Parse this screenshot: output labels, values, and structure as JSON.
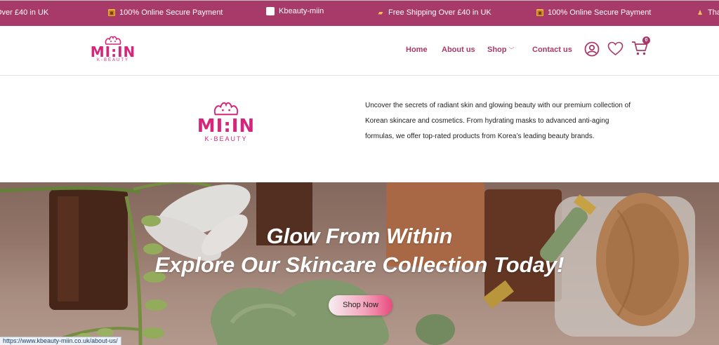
{
  "announcement": {
    "items": [
      {
        "icon": "truck-icon",
        "text": "Over £40 in UK"
      },
      {
        "icon": "gift-icon",
        "text": "100% Online Secure Payment"
      },
      {
        "icon": "logo-icon",
        "text": "Kbeauty-miin"
      },
      {
        "icon": "truck-icon",
        "text": "Free Shipping Over £40 in UK"
      },
      {
        "icon": "gift-icon",
        "text": "100% Online Secure Payment"
      },
      {
        "icon": "person-icon",
        "text": "Tha"
      }
    ]
  },
  "header": {
    "logo": {
      "brand": "MI:IN",
      "sub": "K-BEAUTY"
    },
    "nav": {
      "home": "Home",
      "about": "About us",
      "shop": "Shop",
      "contact": "Contact us"
    },
    "cart_count": "0"
  },
  "intro": {
    "logo": {
      "brand": "MI:IN",
      "sub": "K-BEAUTY"
    },
    "text": "Uncover the secrets of radiant skin and glowing beauty with our premium collection of Korean skincare and cosmetics. From hydrating masks to advanced anti-aging formulas, we offer top-rated products from Korea’s leading beauty brands."
  },
  "hero": {
    "line1": "Glow From Within",
    "line2": "Explore Our Skincare Collection Today!",
    "button": "Shop Now"
  },
  "status_url": "https://www.kbeauty-miin.co.uk/about-us/",
  "colors": {
    "brand": "#a73a68",
    "logo_pink": "#d7267a",
    "nav_text": "#a73a68"
  }
}
